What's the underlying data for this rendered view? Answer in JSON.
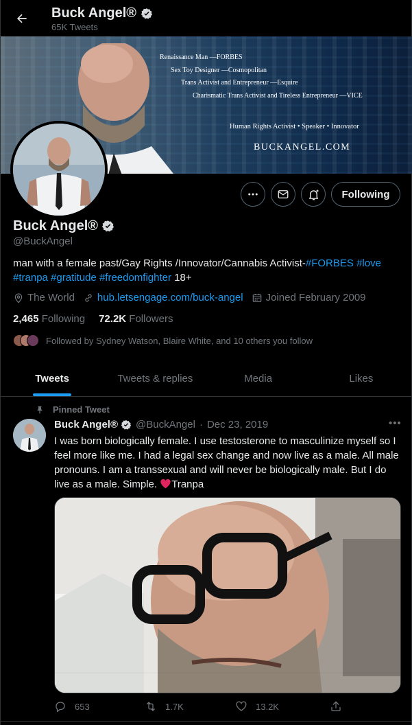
{
  "header": {
    "name": "Buck Angel®",
    "tweet_count": "65K Tweets"
  },
  "banner": {
    "quotes": [
      "Renaissance Man —FORBES",
      "Sex Toy Designer —Cosmopolitan",
      "Trans Activist and Entrepreneur —Esquire",
      "Charismatic Trans Activist and Tireless Entrepreneur —VICE"
    ],
    "tagline": "Human Rights Activist • Speaker • Innovator",
    "site": "BUCKANGEL.COM"
  },
  "actions": {
    "follow_label": "Following"
  },
  "profile": {
    "name": "Buck Angel®",
    "handle": "@BuckAngel",
    "bio_text": "man with a female past/Gay Rights /Innovator/Cannabis Activist-",
    "bio_tags_1": [
      "#FORBES",
      "#love"
    ],
    "bio_tags_2": [
      "#tranpa",
      "#gratitude",
      "#freedomfighter"
    ],
    "bio_suffix": "18+",
    "location": "The World",
    "link": "hub.letsengage.com/buck-angel",
    "joined": "Joined February 2009",
    "following_count": "2,465",
    "following_label": "Following",
    "followers_count": "72.2K",
    "followers_label": "Followers",
    "followed_by": "Followed by Sydney Watson, Blaire White, and 10 others you follow"
  },
  "tabs": [
    {
      "label": "Tweets",
      "active": true
    },
    {
      "label": "Tweets & replies",
      "active": false
    },
    {
      "label": "Media",
      "active": false
    },
    {
      "label": "Likes",
      "active": false
    }
  ],
  "tweet": {
    "pinned_label": "Pinned Tweet",
    "author": "Buck Angel®",
    "handle": "@BuckAngel",
    "date": "Dec 23, 2019",
    "text_before": "I was born biologically female. I use testosterone to masculinize myself so I feel more like me. I had a legal sex change and now live as a male. All male pronouns. I am a transsexual and will never be biologically male. But I do live as a male. Simple. ",
    "text_after": "Tranpa",
    "replies": "653",
    "retweets": "1.7K",
    "likes": "13.2K"
  },
  "colors": {
    "accent": "#1d9bf0",
    "muted": "#71767b",
    "heart": "#f91880"
  },
  "icons": [
    "back-arrow-icon",
    "verified-badge-icon",
    "more-icon",
    "message-icon",
    "notification-bell-icon",
    "location-icon",
    "link-icon",
    "calendar-icon",
    "pin-icon",
    "reply-icon",
    "retweet-icon",
    "like-icon",
    "share-icon"
  ]
}
